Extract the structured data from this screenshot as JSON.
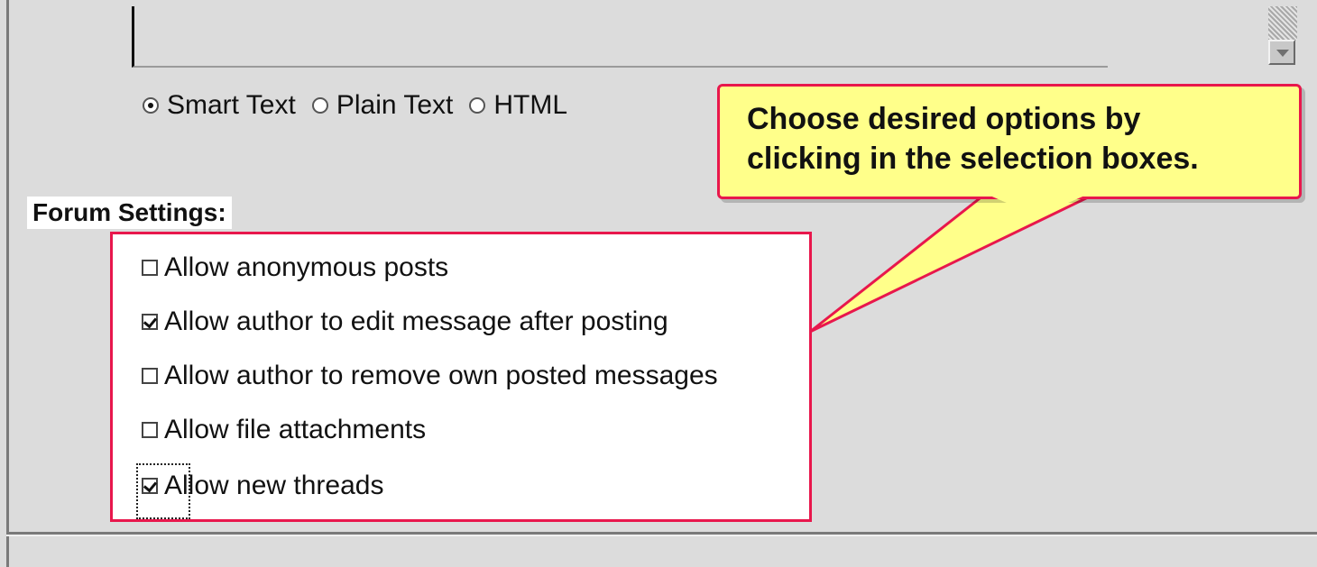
{
  "text_format": {
    "options": [
      {
        "label": "Smart Text",
        "checked": true
      },
      {
        "label": "Plain Text",
        "checked": false
      },
      {
        "label": "HTML",
        "checked": false
      }
    ]
  },
  "callout": {
    "line1": "Choose desired options by",
    "line2": "clicking in the selection boxes.",
    "fill_color": "#ffff8a",
    "border_color": "#e8174c"
  },
  "forum_settings": {
    "title": "Forum Settings:",
    "items": [
      {
        "label": "Allow anonymous posts",
        "checked": false
      },
      {
        "label": "Allow author to edit message after posting",
        "checked": true
      },
      {
        "label": "Allow author to remove own posted messages",
        "checked": false
      },
      {
        "label": "Allow file attachments",
        "checked": false
      },
      {
        "label": "Allow new threads",
        "checked": true,
        "focused": true
      }
    ]
  }
}
